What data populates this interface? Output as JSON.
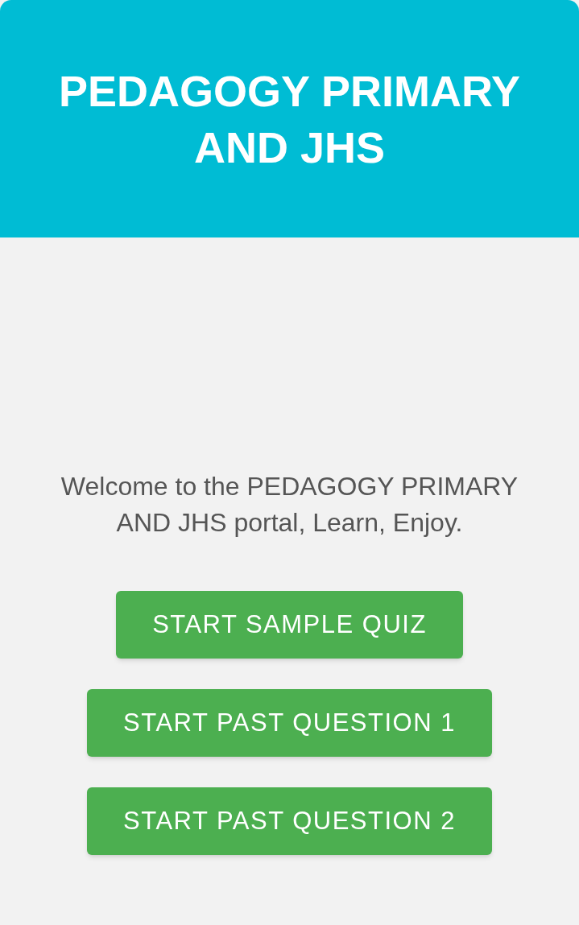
{
  "header": {
    "title": "PEDAGOGY PRIMARY AND JHS"
  },
  "welcome": "Welcome to the PEDAGOGY PRIMARY AND JHS portal, Learn, Enjoy.",
  "buttons": [
    "START SAMPLE QUIZ",
    "START PAST QUESTION 1",
    "START PAST QUESTION 2"
  ]
}
